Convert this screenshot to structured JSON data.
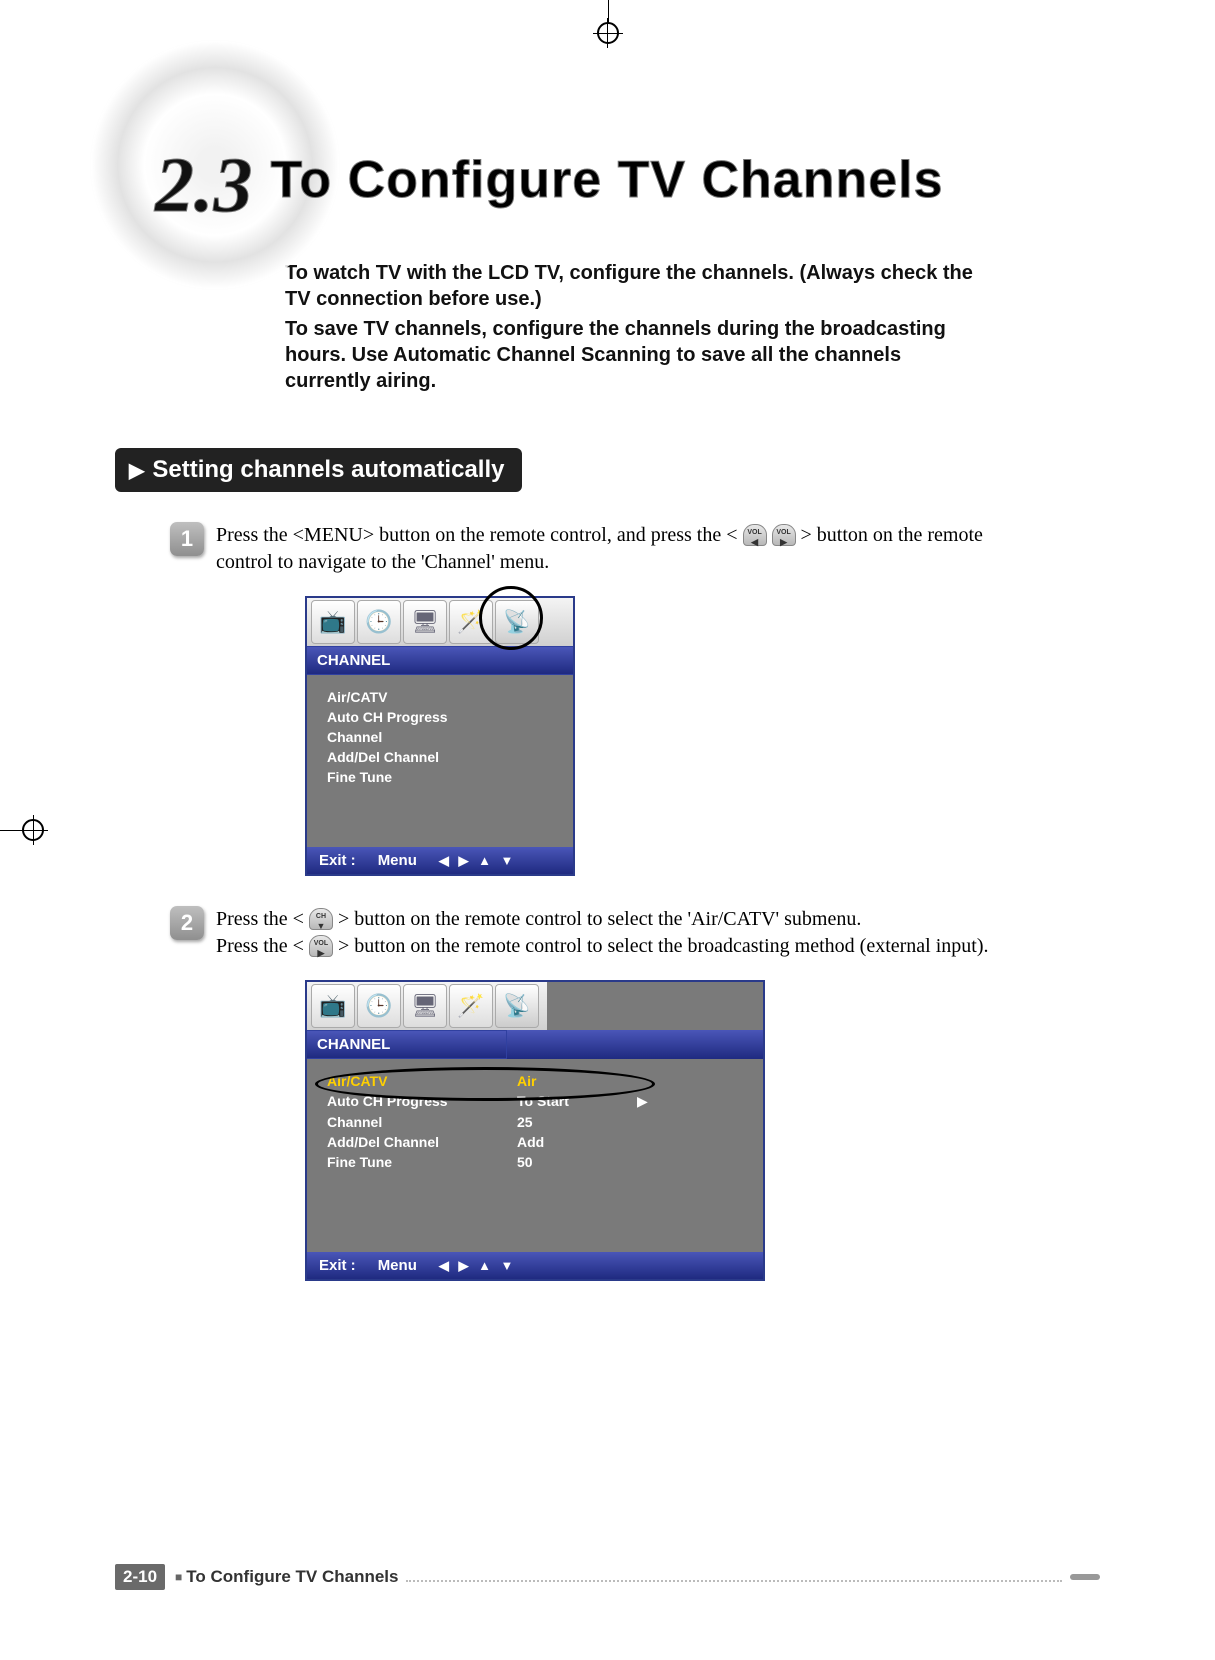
{
  "section_number": "2.3",
  "section_title": "To Configure TV Channels",
  "intro": {
    "p1": "To watch TV with the LCD TV, configure the channels. (Always check the TV connection before use.)",
    "p2": "To save TV channels, configure the channels during the broadcasting hours. Use Automatic Channel Scanning to save all the channels currently airing."
  },
  "subheader": "Setting channels automatically",
  "steps": {
    "s1": {
      "num": "1",
      "text_a": "Press the <MENU> button on the remote control, and press the <",
      "btn1_label": "VOL",
      "btn2_label": "VOL",
      "text_b": "> button on the remote control to navigate to the 'Channel' menu."
    },
    "s2": {
      "num": "2",
      "text_a": "Press the <",
      "btn1_label": "CH",
      "text_b": "> button on the remote control to select the 'Air/CATV' submenu.",
      "text_c": "Press the <",
      "btn2_label": "VOL",
      "text_d": "> button on the remote control to select the broadcasting method (external input)."
    }
  },
  "osd": {
    "title": "CHANNEL",
    "items": [
      "Air/CATV",
      "Auto CH Progress",
      "Channel",
      "Add/Del Channel",
      "Fine Tune"
    ],
    "exit_label": "Exit :",
    "menu_label": "Menu",
    "arrows": "◀ ▶ ▲ ▼"
  },
  "osd2": {
    "title": "CHANNEL",
    "rows": [
      {
        "k": "Air/CATV",
        "v": "Air",
        "sel": true,
        "arrow": false
      },
      {
        "k": "Auto CH Progress",
        "v": "To Start",
        "sel": false,
        "arrow": true
      },
      {
        "k": "Channel",
        "v": "25",
        "sel": false,
        "arrow": false
      },
      {
        "k": "Add/Del Channel",
        "v": "Add",
        "sel": false,
        "arrow": false
      },
      {
        "k": "Fine Tune",
        "v": "50",
        "sel": false,
        "arrow": false
      }
    ],
    "exit_label": "Exit :",
    "menu_label": "Menu",
    "arrows": "◀ ▶ ▲ ▼"
  },
  "tab_icons": [
    "tv-icon",
    "clock-icon",
    "monitor-icon",
    "wand-icon",
    "dish-icon"
  ],
  "footer": {
    "page": "2-10",
    "title": "To Configure TV Channels"
  }
}
